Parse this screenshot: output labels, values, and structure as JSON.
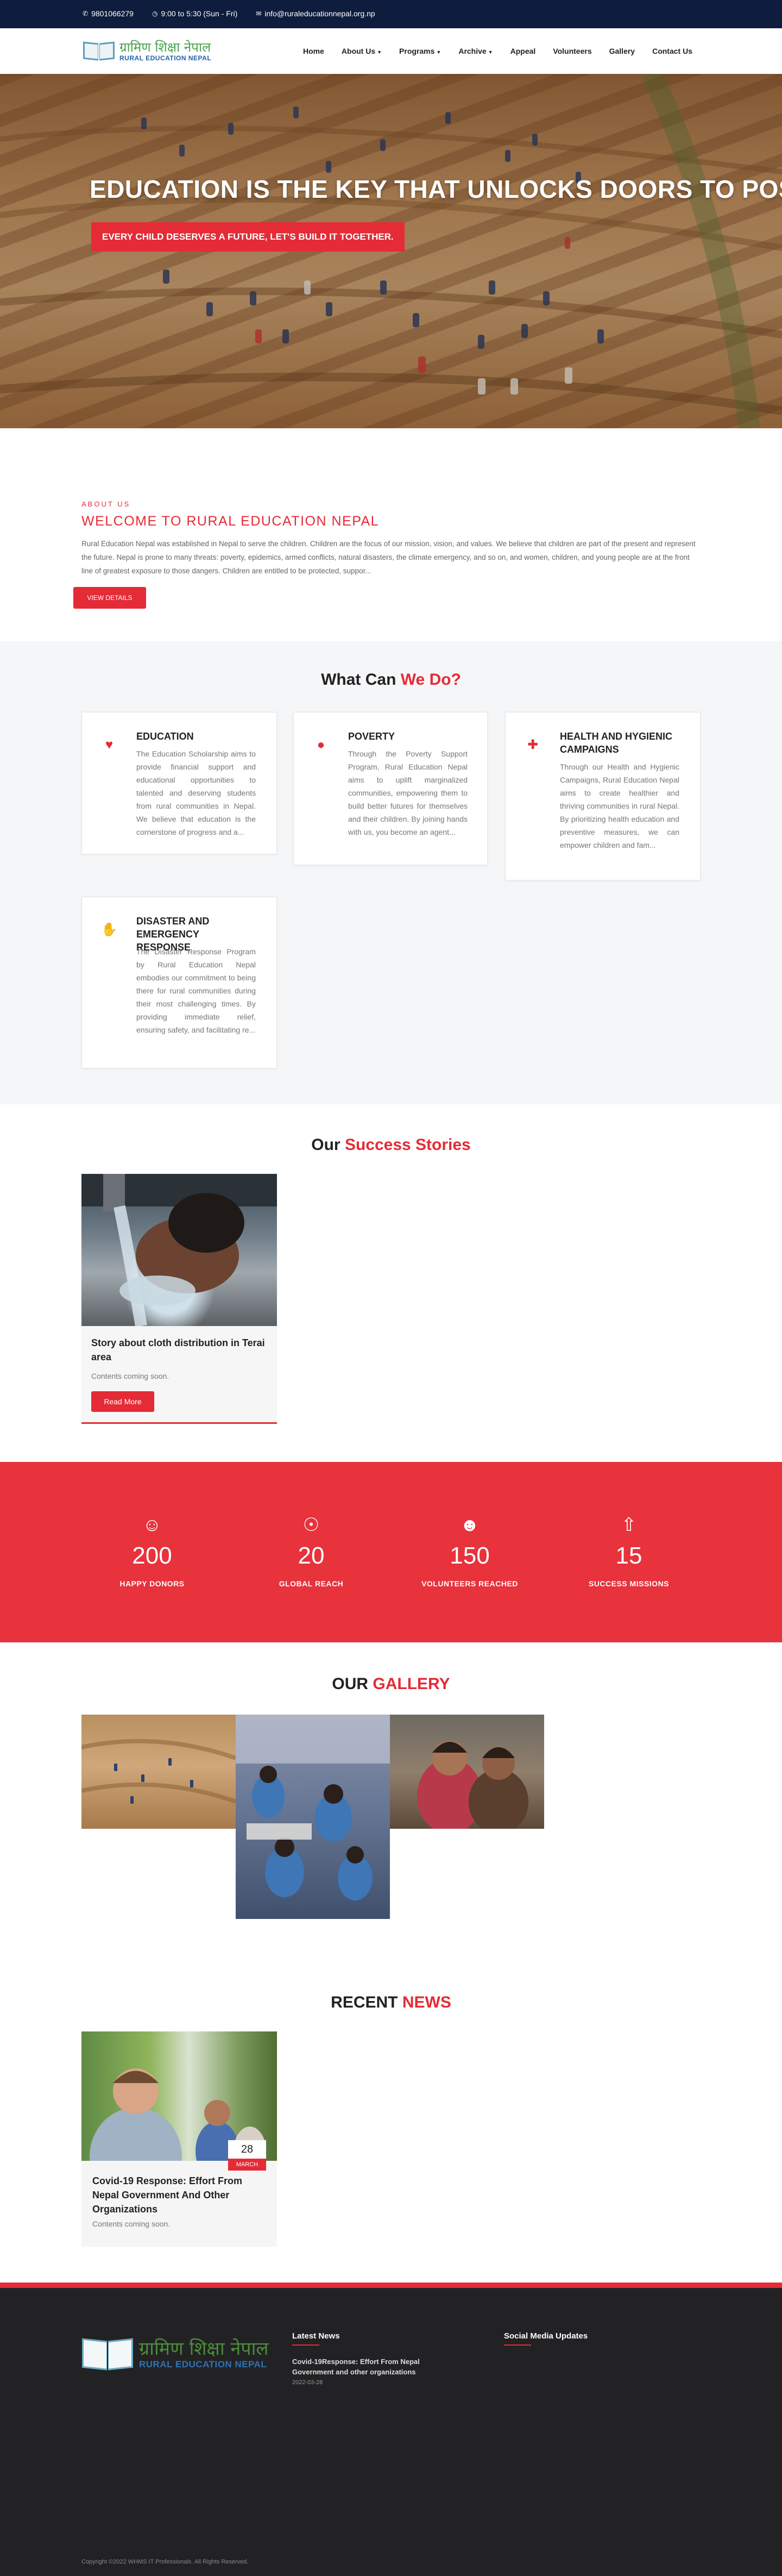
{
  "topbar": {
    "phone": "9801066279",
    "hours": "9:00 to 5:30 (Sun - Fri)",
    "email": "info@ruraleducationnepal.org.np"
  },
  "brand": {
    "name_np": "ग्रामिण शिक्षा नेपाल",
    "name_en": "RURAL EDUCATION NEPAL"
  },
  "nav": {
    "items": [
      {
        "label": "Home"
      },
      {
        "label": "About Us"
      },
      {
        "label": "Programs"
      },
      {
        "label": "Archive"
      },
      {
        "label": "Appeal"
      },
      {
        "label": "Volunteers"
      },
      {
        "label": "Gallery"
      },
      {
        "label": "Contact Us"
      }
    ]
  },
  "hero": {
    "title": "EDUCATION IS THE KEY THAT UNLOCKS DOORS TO POSSIBILITIES",
    "subtitle": "EVERY CHILD DESERVES A FUTURE, LET'S BUILD IT TOGETHER."
  },
  "about": {
    "tag": "ABOUT US",
    "title": "WELCOME TO RURAL EDUCATION NEPAL",
    "text": "Rural Education Nepal was established in Nepal to serve the children. Children are the focus of our mission, vision, and values. We believe that children are part of the present and represent the future. Nepal is prone to many threats: poverty, epidemics, armed conflicts, natural disasters, the climate emergency, and so on, and women, children, and young people are at the front line of greatest exposure to those dangers. Children are entitled to be protected, suppor...",
    "button": "VIEW DETAILS"
  },
  "what_we_do": {
    "title_a": "What Can",
    "title_b": "We Do?",
    "cards": [
      {
        "icon": "hand-heart-icon",
        "title": "EDUCATION",
        "text": "The Education Scholarship aims to provide financial support and educational opportunities to talented and deserving students from rural communities in Nepal. We believe that education is the cornerstone of progress and a..."
      },
      {
        "icon": "hand-coin-icon",
        "title": "POVERTY",
        "text": "Through the Poverty Support Program, Rural Education Nepal aims to uplift marginalized communities, empowering them to build better futures for themselves and their children. By joining hands with us, you become an agent..."
      },
      {
        "icon": "hands-care-icon",
        "title": "HEALTH AND HYGIENIC CAMPAIGNS",
        "text": "Through our Health and Hygienic Campaigns, Rural Education Nepal aims to create healthier and thriving communities in rural Nepal. By prioritizing health education and preventive measures, we can empower children and fam..."
      },
      {
        "icon": "helping-hand-icon",
        "title": "DISASTER AND EMERGENCY RESPONSE",
        "text": "The Disaster Response Program by Rural Education Nepal embodies our commitment to being there for rural communities during their most challenging times. By providing immediate relief, ensuring safety, and facilitating re..."
      }
    ]
  },
  "stories": {
    "title_a": "Our",
    "title_b": "Success Stories",
    "items": [
      {
        "title": "Story about cloth distribution in Terai area",
        "text": "Contents coming soon.",
        "button": "Read More"
      }
    ]
  },
  "stats": [
    {
      "icon": "smile-icon",
      "value": "200",
      "label": "HAPPY DONORS"
    },
    {
      "icon": "globe-icon",
      "value": "20",
      "label": "GLOBAL REACH"
    },
    {
      "icon": "user-plus-icon",
      "value": "150",
      "label": "VOLUNTEERS REACHED"
    },
    {
      "icon": "rocket-icon",
      "value": "15",
      "label": "SUCCESS MISSIONS"
    }
  ],
  "gallery": {
    "title_a": "OUR",
    "title_b": "GALLERY"
  },
  "news": {
    "title_a": "RECENT",
    "title_b": "NEWS",
    "items": [
      {
        "day": "28",
        "month": "MARCH",
        "title": "Covid-19 Response: Effort From Nepal Government And Other Organizations",
        "text": "Contents coming soon."
      }
    ]
  },
  "footer": {
    "latest_news_heading": "Latest News",
    "latest_news_link": "Covid-19Response: Effort From Nepal Government and other organizations",
    "latest_news_date": "2022-03-28",
    "social_heading": "Social Media Updates",
    "copyright": "Copyright ©2022 WHMS IT Professionals. All Rights Reserved."
  },
  "colors": {
    "accent": "#e52b36",
    "topbar": "#0e1d3d",
    "footer": "#222224"
  }
}
